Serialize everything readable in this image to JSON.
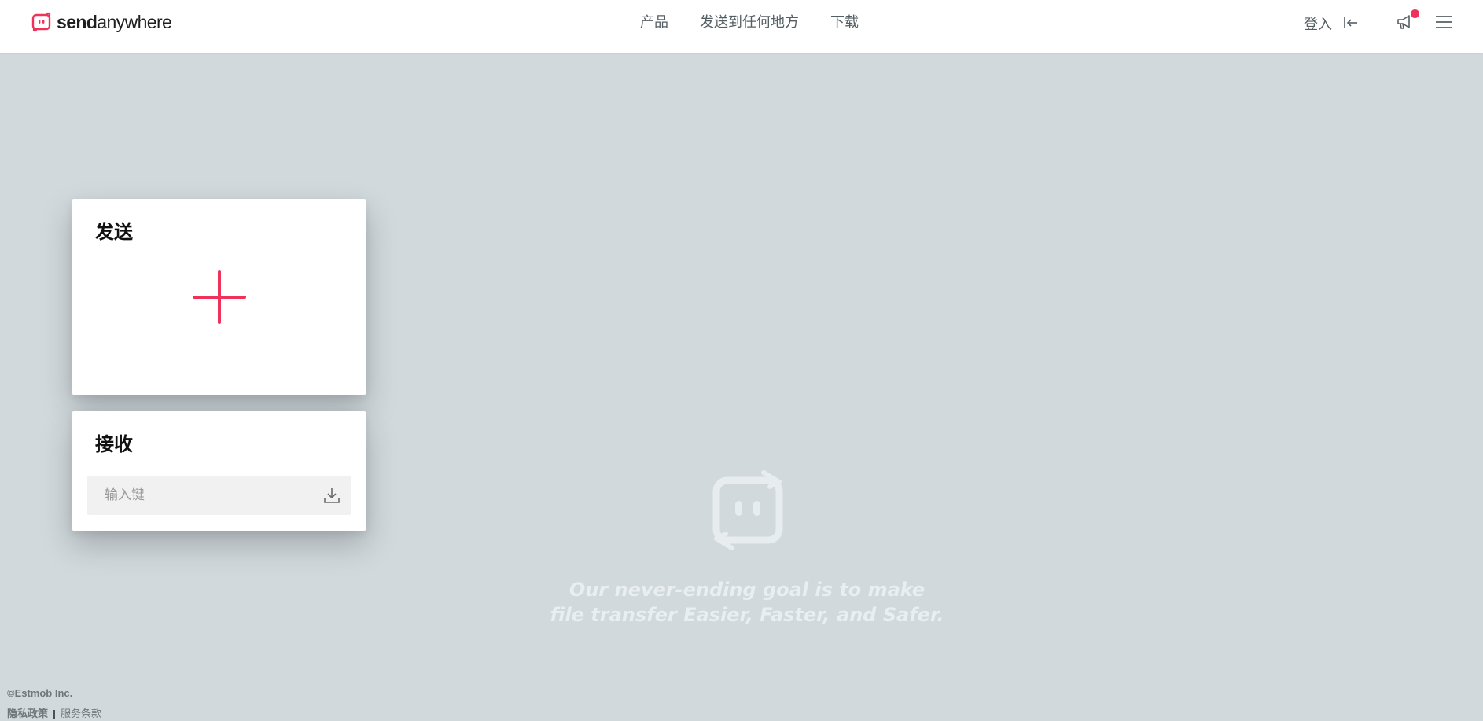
{
  "header": {
    "logo": {
      "bold": "send",
      "regular": "anywhere",
      "icon": "sendanywhere-logo-icon"
    },
    "nav": [
      {
        "label": "产品"
      },
      {
        "label": "发送到任何地方"
      },
      {
        "label": "下载"
      }
    ],
    "login": {
      "label": "登入",
      "icon": "login-arrow-icon"
    },
    "announcement": {
      "icon": "megaphone-icon",
      "has_unread": true
    },
    "menu": {
      "icon": "hamburger-menu-icon"
    }
  },
  "send_card": {
    "title": "发送",
    "add_icon": "plus-icon"
  },
  "receive_card": {
    "title": "接收",
    "key_input": {
      "placeholder": "输入键",
      "value": ""
    },
    "download_icon": "download-icon"
  },
  "hero": {
    "mark_icon": "sendanywhere-watermark-icon",
    "tagline_line1": "Our never-ending goal is to make",
    "tagline_line2": "file transfer Easier, Faster, and Safer."
  },
  "footer": {
    "copyright": "©Estmob Inc.",
    "privacy": "隐私政策",
    "terms": "服务条款"
  },
  "colors": {
    "brand": "#f0325a",
    "background": "#d1d9dd",
    "header_bg": "#ffffff",
    "nav_text": "#555f63"
  }
}
